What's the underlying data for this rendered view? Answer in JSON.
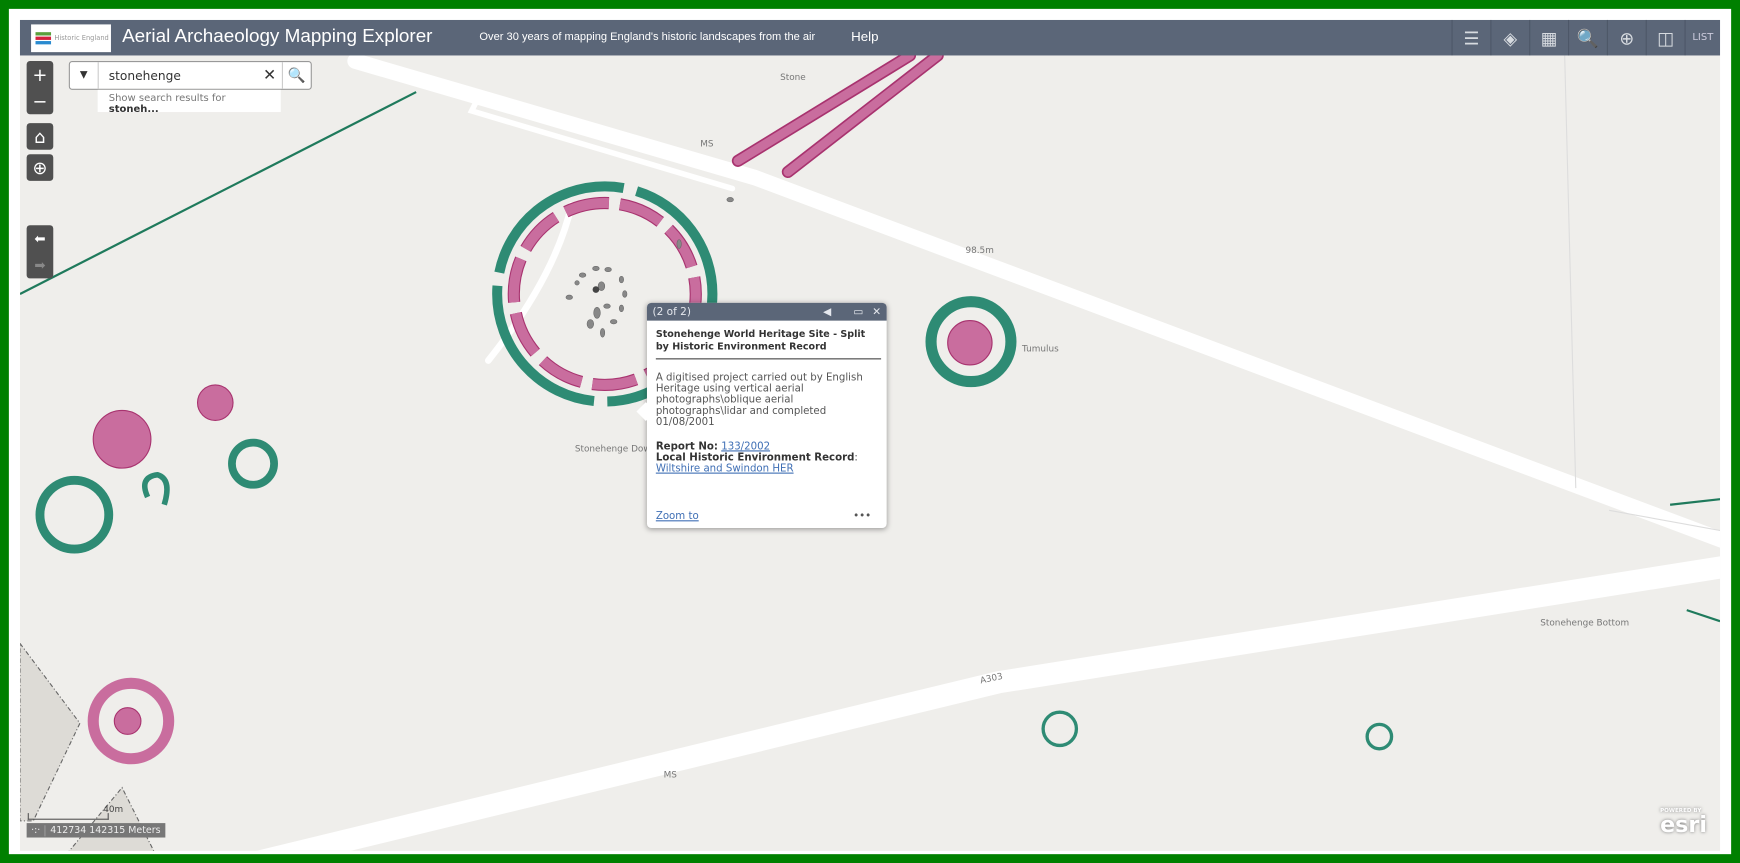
{
  "header": {
    "logo_text": "Historic England",
    "title": "Aerial Archaeology Mapping Explorer",
    "tagline": "Over 30 years of mapping England's historic landscapes from the air",
    "help": "Help",
    "tools": [
      {
        "name": "legend-icon",
        "glyph": "☰"
      },
      {
        "name": "layers-icon",
        "glyph": "◈"
      },
      {
        "name": "basemap-gallery-icon",
        "glyph": "▦"
      },
      {
        "name": "query-icon",
        "glyph": "🔍"
      },
      {
        "name": "add-data-icon",
        "glyph": "⊕"
      },
      {
        "name": "swipe-icon",
        "glyph": "◫"
      }
    ],
    "list_label": "LIST"
  },
  "controls": {
    "zoom_in": "+",
    "zoom_out": "−",
    "home": "⌂",
    "locate": "⊕",
    "back": "⬅",
    "forward": "➡"
  },
  "search": {
    "value": "stonehenge",
    "suggestion_prefix": "Show search results for ",
    "suggestion_term": "stoneh..."
  },
  "map_labels": {
    "stone": "Stone",
    "ms1": "MS",
    "elev": "98.5m",
    "tumulus": "Tumulus",
    "down": "Stonehenge Down",
    "bottom": "Stonehenge Bottom",
    "a303": "A303",
    "ms2": "MS"
  },
  "popup": {
    "counter": "(2 of 2)",
    "title": "Stonehenge World Heritage Site - Split by Historic Environment Record",
    "description": "A digitised project carried out by English Heritage using vertical aerial photographs\\oblique aerial photographs\\lidar and completed 01/08/2001",
    "report_label": "Report No:",
    "report_value": "133/2002",
    "her_label": "Local Historic Environment Record",
    "her_value": "Wiltshire and Swindon HER",
    "zoom_to": "Zoom to",
    "more": "•••"
  },
  "footer": {
    "scale": "40m",
    "coordinates": "412734 142315 Meters",
    "esri_powered": "POWERED BY",
    "esri": "esri"
  },
  "colors": {
    "header": "#5b6678",
    "frame": "#008000",
    "pink": "#c96d9e",
    "green": "#2e8b74"
  }
}
